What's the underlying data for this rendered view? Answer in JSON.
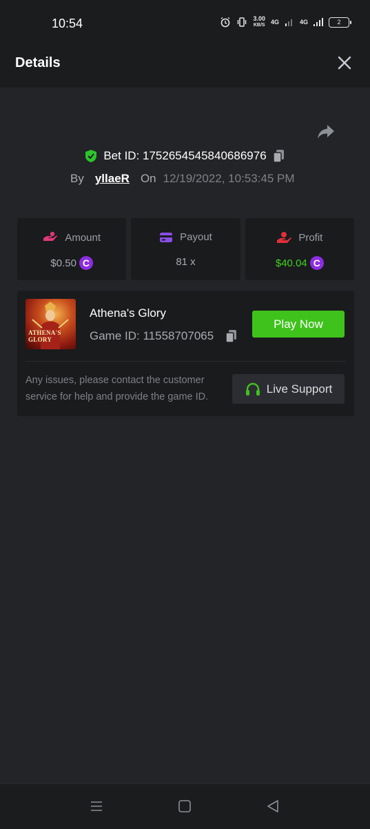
{
  "status_bar": {
    "time": "10:54",
    "net_speed_value": "3.00",
    "net_speed_unit": "KB/S",
    "signal_1": "4G",
    "signal_2": "4G",
    "battery": "2"
  },
  "header": {
    "title": "Details"
  },
  "bet": {
    "id_label": "Bet ID: 1752654545840686976",
    "by_label": "By",
    "username": "yllaeR",
    "on_label": "On",
    "datetime": "12/19/2022, 10:53:45 PM"
  },
  "stats": [
    {
      "label": "Amount",
      "value": "$0.50",
      "icon": "hand-coins-icon",
      "has_coin": true,
      "color": "#a9abb0"
    },
    {
      "label": "Payout",
      "value": "81 x",
      "icon": "card-icon",
      "has_coin": false,
      "color": "#a9abb0"
    },
    {
      "label": "Profit",
      "value": "$40.04",
      "icon": "profit-hand-icon",
      "has_coin": true,
      "color": "#3fd31a"
    }
  ],
  "coin_symbol": "C",
  "game": {
    "thumb_text": "ATHENA'S GLORY",
    "title": "Athena's Glory",
    "game_id": "Game ID: 11558707065",
    "play_label": "Play Now",
    "issue_text": "Any issues, please contact the customer service for help and provide the game ID.",
    "support_label": "Live Support"
  },
  "colors": {
    "accent_green": "#3fc21c",
    "coin_purple": "#8d2de2",
    "background": "#232427",
    "panel": "#1a1b1d"
  }
}
